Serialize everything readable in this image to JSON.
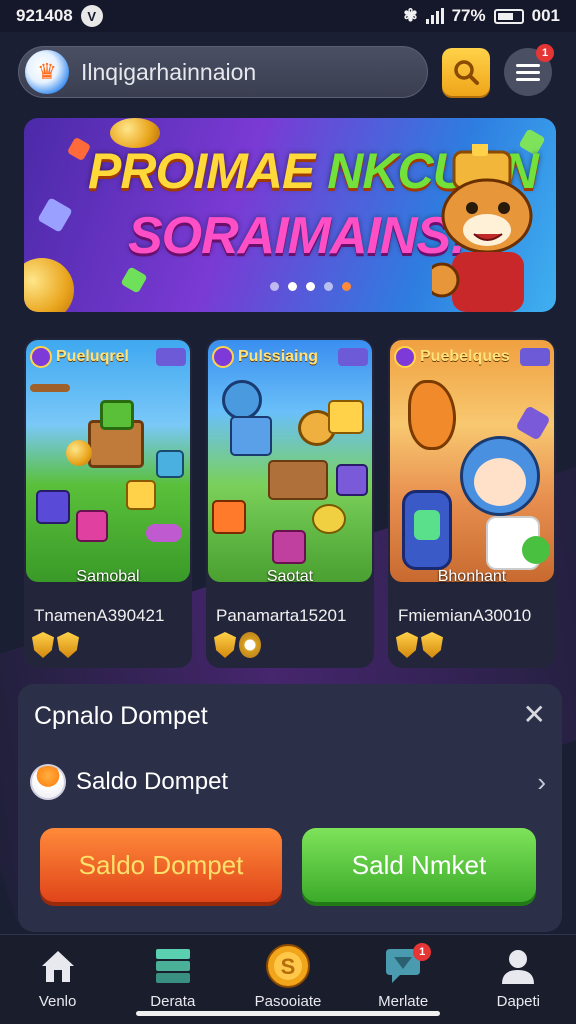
{
  "status_bar": {
    "time": "921408",
    "battery": "77%",
    "extra": "001"
  },
  "header": {
    "search_placeholder": "Ilnqigarhainnaion",
    "menu_badge": "1"
  },
  "banner": {
    "title_part1": "PROIMAE ",
    "title_part2": "NKCUAN",
    "subtitle": "SORAIMAINS!",
    "slides": 5,
    "active_slide": 3
  },
  "games": [
    {
      "tag": "Pueluqrel",
      "art_label": "Samobal",
      "name": "TnamenA390421",
      "rating_icons": 2
    },
    {
      "tag": "Pulssiaing",
      "art_label": "Saotat",
      "name": "Panamarta15201",
      "rating_icons": 2
    },
    {
      "tag": "Puebelques",
      "art_label": "Bhonhant",
      "name": "FmiemianA30010",
      "rating_icons": 2
    }
  ],
  "wallet": {
    "title": "Cpnalo Dompet",
    "close_icon": "close-icon",
    "row_label": "Saldo Dompet",
    "primary_button": "Saldo Dompet",
    "secondary_button": "Sald Nmket"
  },
  "nav": [
    {
      "label": "Venlo",
      "icon": "home-icon"
    },
    {
      "label": "Derata",
      "icon": "stack-icon"
    },
    {
      "label": "Pasooiate",
      "icon": "coin-icon"
    },
    {
      "label": "Merlate",
      "icon": "chat-icon",
      "badge": "1"
    },
    {
      "label": "Dapeti",
      "icon": "profile-icon"
    }
  ],
  "colors": {
    "background": "#1b1f33",
    "accent_orange": "#e0451a",
    "accent_green": "#3cab2a",
    "accent_yellow": "#f0a51a",
    "badge_red": "#e53535"
  }
}
